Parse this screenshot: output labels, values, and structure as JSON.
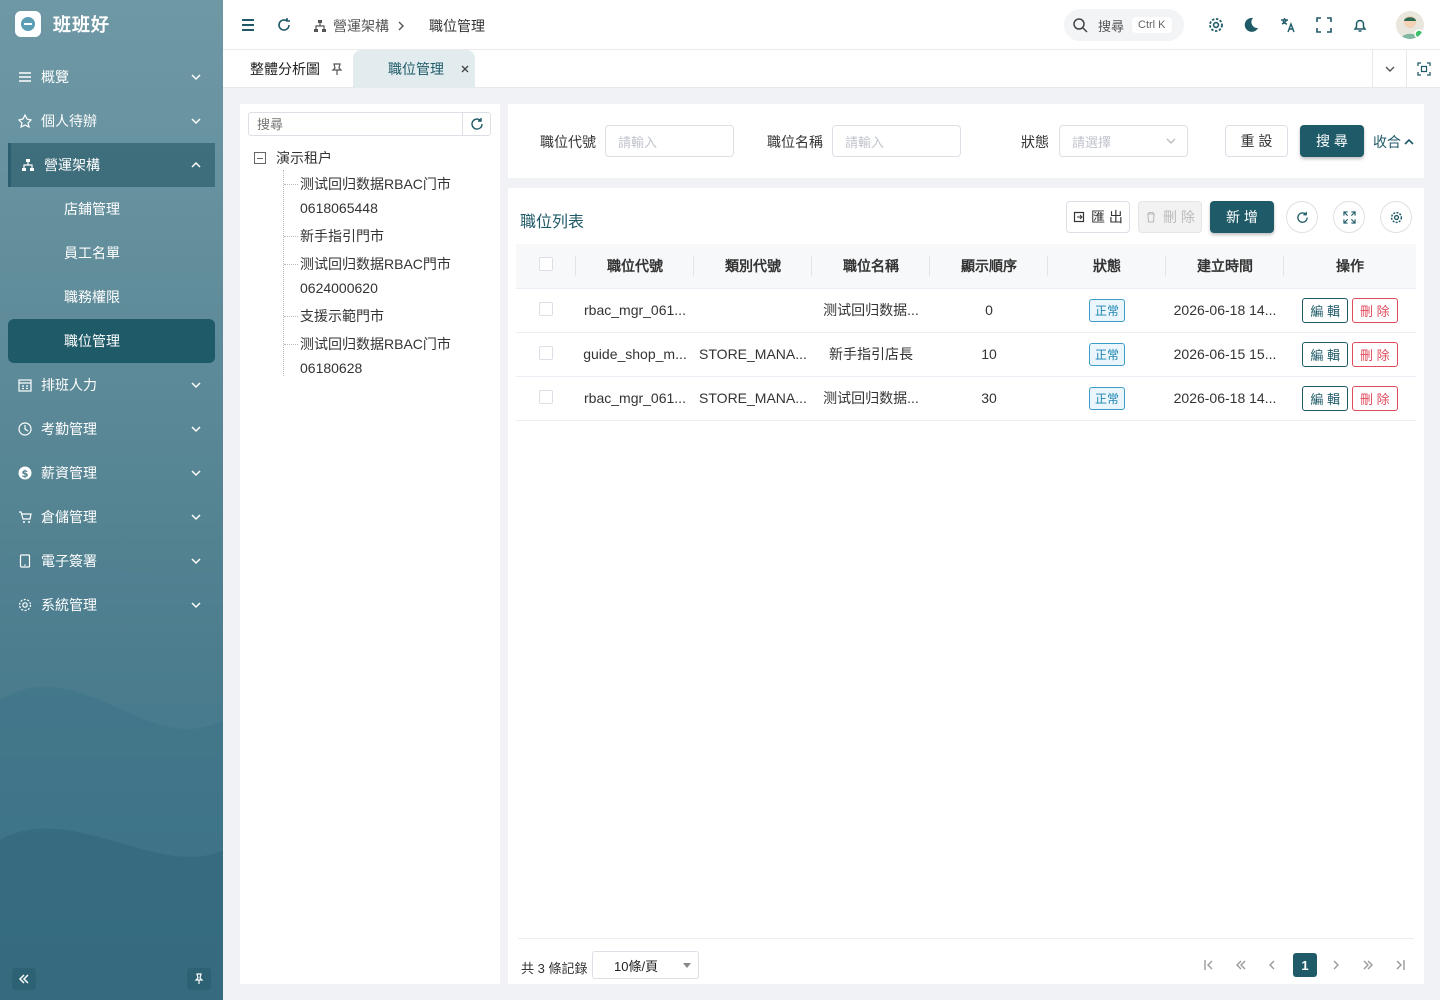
{
  "app": {
    "name": "班班好"
  },
  "sidebar": {
    "items": [
      {
        "label": "概覽",
        "icon": "overview-icon"
      },
      {
        "label": "個人待辦",
        "icon": "todo-icon"
      },
      {
        "label": "營運架構",
        "icon": "org-icon",
        "expanded": true,
        "children": [
          "店鋪管理",
          "員工名單",
          "職務權限",
          "職位管理"
        ],
        "selected": "職位管理"
      },
      {
        "label": "排班人力",
        "icon": "calendar-icon"
      },
      {
        "label": "考勤管理",
        "icon": "clock-icon"
      },
      {
        "label": "薪資管理",
        "icon": "dollar-icon"
      },
      {
        "label": "倉儲管理",
        "icon": "cart-icon"
      },
      {
        "label": "電子簽署",
        "icon": "tablet-icon"
      },
      {
        "label": "系統管理",
        "icon": "gear-icon"
      }
    ]
  },
  "header": {
    "breadcrumb": [
      "營運架構",
      "職位管理"
    ],
    "search_label": "搜尋",
    "search_shortcut": "Ctrl K"
  },
  "tabs": [
    {
      "label": "整體分析圖",
      "pinned": true
    },
    {
      "label": "職位管理",
      "active": true,
      "closable": true
    }
  ],
  "tree": {
    "search_placeholder": "搜尋",
    "root": "演示租户",
    "nodes": [
      {
        "line1": "测试回归数据RBAC门市",
        "line2": "0618065448"
      },
      {
        "line1": "新手指引門市",
        "line2": ""
      },
      {
        "line1": "测试回归数据RBAC門市",
        "line2": "0624000620"
      },
      {
        "line1": "支援示範門市",
        "line2": ""
      },
      {
        "line1": "测试回归数据RBAC门市",
        "line2": "06180628"
      }
    ]
  },
  "filter": {
    "code_label": "職位代號",
    "code_placeholder": "請輸入",
    "name_label": "職位名稱",
    "name_placeholder": "請輸入",
    "status_label": "狀態",
    "status_placeholder": "請選擇",
    "reset": "重 設",
    "search": "搜 尋",
    "collapse": "收合"
  },
  "list": {
    "title": "職位列表",
    "export": "匯 出",
    "delete": "刪 除",
    "add": "新 增",
    "columns": [
      "職位代號",
      "類別代號",
      "職位名稱",
      "顯示順序",
      "狀態",
      "建立時間",
      "操作"
    ],
    "rows": [
      {
        "code": "rbac_mgr_061...",
        "category": "",
        "name": "测试回归数据...",
        "order": "0",
        "status": "正常",
        "created": "2026-06-18 14..."
      },
      {
        "code": "guide_shop_m...",
        "category": "STORE_MANA...",
        "name": "新手指引店長",
        "order": "10",
        "status": "正常",
        "created": "2026-06-15 15..."
      },
      {
        "code": "rbac_mgr_061...",
        "category": "STORE_MANA...",
        "name": "测试回归数据...",
        "order": "30",
        "status": "正常",
        "created": "2026-06-18 14..."
      }
    ],
    "edit_label": "編 輯",
    "del_label": "刪 除"
  },
  "pager": {
    "total": "共 3 條記錄",
    "page_size": "10條/頁",
    "current": "1"
  },
  "colors": {
    "accent": "#1f5a68",
    "status": "#1d84b5",
    "danger": "#e04b5c"
  }
}
